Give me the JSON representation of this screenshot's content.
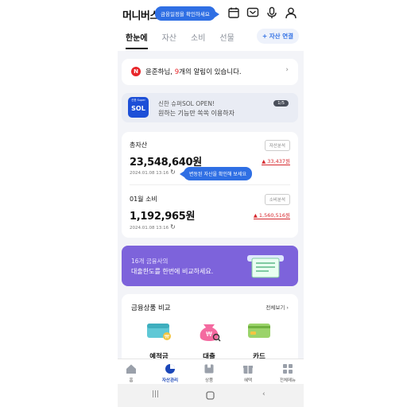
{
  "header": {
    "brand": "머니버스",
    "tooltip_top": "금융일정을 확인하세요",
    "tabs": [
      "한눈에",
      "자산",
      "소비",
      "선물"
    ],
    "connect_label": "+ 자산 연결"
  },
  "alarm": {
    "prefix": "윤준하님, ",
    "count": "9",
    "suffix": "개의 알림이 있습니다."
  },
  "banner": {
    "logo_small": "신한 Super",
    "logo": "SOL",
    "line1": "신한 슈퍼SOL OPEN!",
    "line2": "원하는 기능만 쏙쏙 이용하자",
    "pager": "1/5"
  },
  "assets": {
    "total_label": "총자산",
    "total_amount": "23,548,640원",
    "total_time": "2024.01.08 13:16",
    "total_pill": "자산분석",
    "total_delta": "▲ 33,437원",
    "tooltip_mid": "변동된 자산을 확인해 보세요",
    "spend_label": "01월 소비",
    "spend_amount": "1,192,965원",
    "spend_time": "2024.01.08 13:16",
    "spend_pill": "소비분석",
    "spend_delta": "▲ 1,560,516원"
  },
  "loan": {
    "line1": "16개 금융사의",
    "line2": "대출한도를 한번에 비교하세요."
  },
  "compare": {
    "title": "금융상품 비교",
    "all_label": "전체보기 ›",
    "products": [
      "예적금",
      "대출",
      "카드"
    ]
  },
  "bottom_nav": [
    "홈",
    "자산관리",
    "상품",
    "혜택",
    "전체메뉴"
  ],
  "colors": {
    "accent": "#2f6fe4",
    "brand_blue": "#1a46b8",
    "up_red": "#d6272d",
    "purple": "#7d63db"
  }
}
